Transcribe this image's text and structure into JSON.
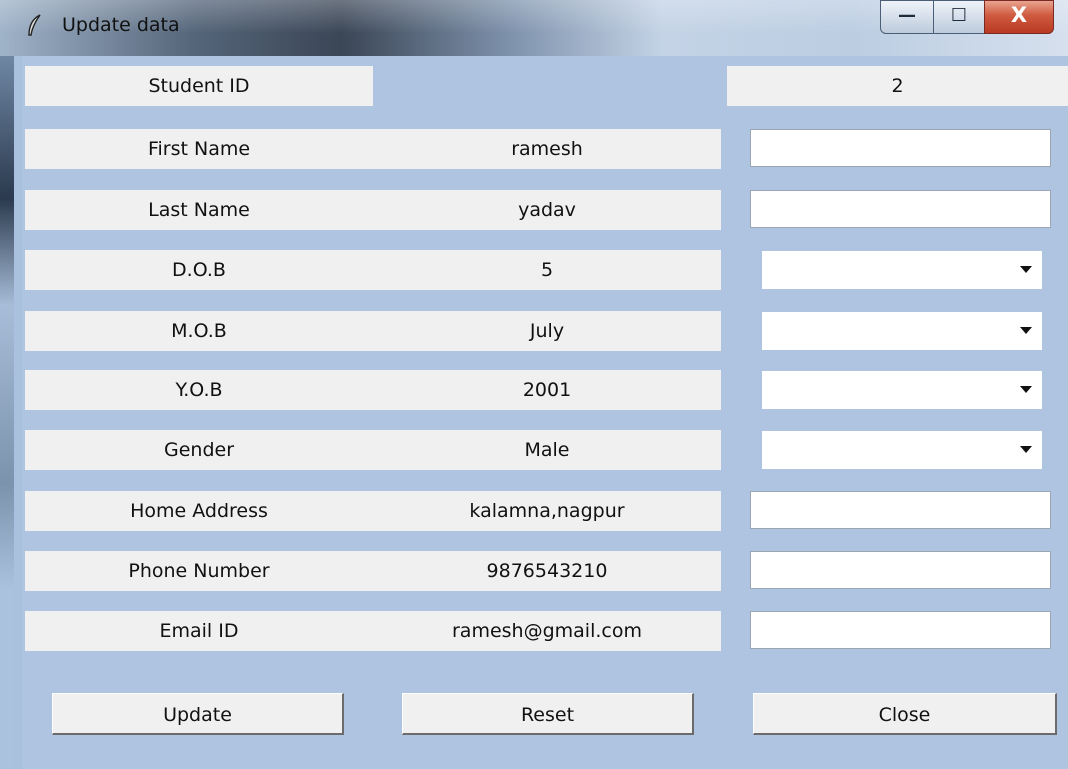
{
  "window": {
    "title": "Update data"
  },
  "caption": {
    "minimize": "—",
    "maximize": "☐",
    "close": "X"
  },
  "student_id": {
    "label": "Student ID",
    "value": "2"
  },
  "rows": [
    {
      "label": "First Name",
      "current": "ramesh",
      "control": "entry",
      "value": ""
    },
    {
      "label": "Last Name",
      "current": "yadav",
      "control": "entry",
      "value": ""
    },
    {
      "label": "D.O.B",
      "current": "5",
      "control": "combo",
      "value": ""
    },
    {
      "label": "M.O.B",
      "current": "July",
      "control": "combo",
      "value": ""
    },
    {
      "label": "Y.O.B",
      "current": "2001",
      "control": "combo",
      "value": ""
    },
    {
      "label": "Gender",
      "current": "Male",
      "control": "combo",
      "value": ""
    },
    {
      "label": "Home Address",
      "current": "kalamna,nagpur",
      "control": "entry",
      "value": ""
    },
    {
      "label": "Phone Number",
      "current": "9876543210",
      "control": "entry",
      "value": ""
    },
    {
      "label": "Email ID",
      "current": "ramesh@gmail.com",
      "control": "entry",
      "value": ""
    }
  ],
  "buttons": {
    "update": "Update",
    "reset": "Reset",
    "close": "Close"
  },
  "icons": {
    "app": "feather-icon",
    "dropdown": "chevron-down-icon"
  }
}
